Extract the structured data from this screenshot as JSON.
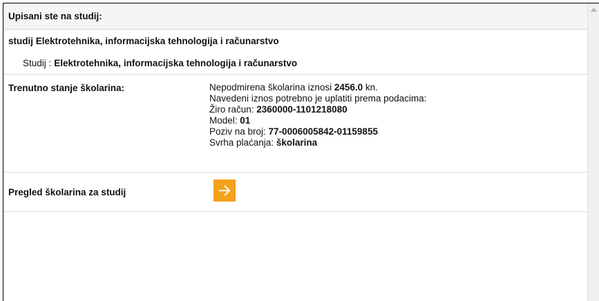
{
  "header": {
    "title": "Upisani ste na studij:"
  },
  "study": {
    "heading": "studij Elektrotehnika, informacijska tehnologija i računarstvo",
    "studij_label": "Studij :",
    "studij_value": "Elektrotehnika, informacijska tehnologija i računarstvo"
  },
  "tuition": {
    "label": "Trenutno stanje školarina:",
    "line1_prefix": "Nepodmirena školarina iznosi ",
    "amount": "2456.0",
    "line1_suffix": " kn.",
    "line2": "Navedeni iznos potrebno je uplatiti prema podacima:",
    "account_label": "Žiro račun: ",
    "account_value": "2360000-1101218080",
    "model_label": "Model: ",
    "model_value": "01",
    "reference_label": "Poziv na broj: ",
    "reference_value": "77-0006005842-01159855",
    "purpose_label": "Svrha plaćanja: ",
    "purpose_value": "školarina"
  },
  "overview": {
    "label": "Pregled školarina za studij",
    "button_icon": "arrow-right-icon"
  },
  "colors": {
    "accent": "#f4a11c",
    "header_bg": "#f5f5f5"
  }
}
